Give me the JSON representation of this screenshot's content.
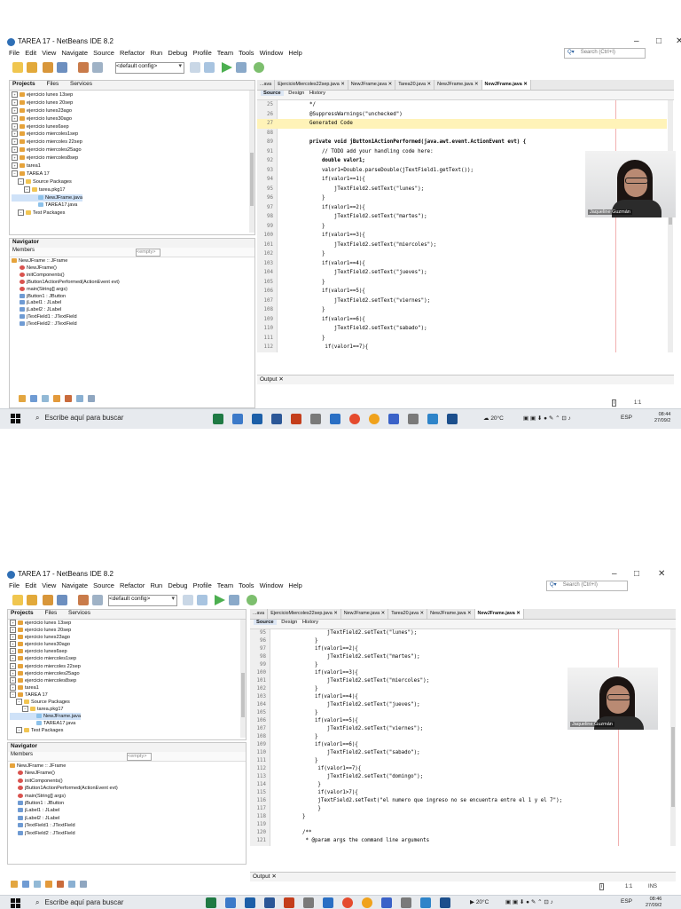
{
  "window": {
    "title": "TAREA 17 - NetBeans IDE 8.2",
    "minimize": "–",
    "maximize": "□",
    "close": "✕"
  },
  "menu": [
    "File",
    "Edit",
    "View",
    "Navigate",
    "Source",
    "Refactor",
    "Run",
    "Debug",
    "Profile",
    "Team",
    "Tools",
    "Window",
    "Help"
  ],
  "search_placeholder": "Search (Ctrl+I)",
  "config_select": "<default config>",
  "projects_tabs": [
    "Projects",
    "Files",
    "Services"
  ],
  "projects": [
    {
      "label": "ejercicio lunes 13sep",
      "indent": 0
    },
    {
      "label": "ejercicio lunes 20sep",
      "indent": 0
    },
    {
      "label": "ejercicio lunes23ago",
      "indent": 0
    },
    {
      "label": "ejercicio lunes30ago",
      "indent": 0
    },
    {
      "label": "ejercicio lunes6sep",
      "indent": 0
    },
    {
      "label": "ejercicio miercoles1sep",
      "indent": 0
    },
    {
      "label": "ejercicio miercoles 22sep",
      "indent": 0
    },
    {
      "label": "ejercicio miercoles25ago",
      "indent": 0
    },
    {
      "label": "ejercicio miercoles8sep",
      "indent": 0
    },
    {
      "label": "tarea1",
      "indent": 0
    },
    {
      "label": "TAREA 17",
      "indent": 0
    },
    {
      "label": "Source Packages",
      "indent": 1
    },
    {
      "label": "tarea.pkg17",
      "indent": 2
    },
    {
      "label": "NewJFrame.java",
      "indent": 3
    },
    {
      "label": "TAREA17.java",
      "indent": 3
    },
    {
      "label": "Test Packages",
      "indent": 1
    }
  ],
  "navigator": {
    "title": "Navigator",
    "members_label": "Members",
    "empty_select": "<empty>",
    "items": [
      {
        "label": "NewJFrame :: JFrame",
        "indent": 0
      },
      {
        "label": "NewJFrame()",
        "indent": 1
      },
      {
        "label": "initComponents()",
        "indent": 1
      },
      {
        "label": "jButton1ActionPerformed(ActionEvent evt)",
        "indent": 1
      },
      {
        "label": "main(String[] args)",
        "indent": 1
      },
      {
        "label": "jButton1 : JButton",
        "indent": 1
      },
      {
        "label": "jLabel1 : JLabel",
        "indent": 1
      },
      {
        "label": "jLabel2 : JLabel",
        "indent": 1
      },
      {
        "label": "jTextField1 : JTextField",
        "indent": 1
      },
      {
        "label": "jTextField2 : JTextField",
        "indent": 1
      }
    ]
  },
  "editor_tabs": [
    "...ava",
    "EjercicioMiercoles22sep.java",
    "NewJFrame.java",
    "Tarea20.java",
    "NewJFrame.java",
    "NewJFrame.java"
  ],
  "editor_toolbar": {
    "source": "Source",
    "design": "Design",
    "history": "History"
  },
  "code_top": [
    {
      "n": "25",
      "t": "  */"
    },
    {
      "n": "26",
      "t": "  @SuppressWarnings(\"unchecked\")"
    },
    {
      "n": "27",
      "t": "  Generated Code"
    },
    {
      "n": "88",
      "t": ""
    },
    {
      "n": "89",
      "t": "  private void jButton1ActionPerformed(java.awt.event.ActionEvent evt) {"
    },
    {
      "n": "91",
      "t": "      // TODO add your handling code here:"
    },
    {
      "n": "92",
      "t": "      double valor1;"
    },
    {
      "n": "93",
      "t": "      valor1=Double.parseDouble(jTextField1.getText());"
    },
    {
      "n": "94",
      "t": "      if(valor1==1){"
    },
    {
      "n": "95",
      "t": "          jTextField2.setText(\"lunes\");"
    },
    {
      "n": "96",
      "t": "      }"
    },
    {
      "n": "97",
      "t": "      if(valor1==2){"
    },
    {
      "n": "98",
      "t": "          jTextField2.setText(\"martes\");"
    },
    {
      "n": "99",
      "t": "      }"
    },
    {
      "n": "100",
      "t": "      if(valor1==3){"
    },
    {
      "n": "101",
      "t": "          jTextField2.setText(\"miercoles\");"
    },
    {
      "n": "102",
      "t": "      }"
    },
    {
      "n": "103",
      "t": "      if(valor1==4){"
    },
    {
      "n": "104",
      "t": "          jTextField2.setText(\"jueves\");"
    },
    {
      "n": "105",
      "t": "      }"
    },
    {
      "n": "106",
      "t": "      if(valor1==5){"
    },
    {
      "n": "107",
      "t": "          jTextField2.setText(\"viernes\");"
    },
    {
      "n": "108",
      "t": "      }"
    },
    {
      "n": "109",
      "t": "      if(valor1==6){"
    },
    {
      "n": "110",
      "t": "          jTextField2.setText(\"sabado\");"
    },
    {
      "n": "111",
      "t": "      }"
    },
    {
      "n": "112",
      "t": "       if(valor1==7){"
    }
  ],
  "code_bottom": [
    {
      "n": "95",
      "t": "          jTextField2.setText(\"lunes\");"
    },
    {
      "n": "96",
      "t": "      }"
    },
    {
      "n": "97",
      "t": "      if(valor1==2){"
    },
    {
      "n": "98",
      "t": "          jTextField2.setText(\"martes\");"
    },
    {
      "n": "99",
      "t": "      }"
    },
    {
      "n": "100",
      "t": "      if(valor1==3){"
    },
    {
      "n": "101",
      "t": "          jTextField2.setText(\"miercoles\");"
    },
    {
      "n": "102",
      "t": "      }"
    },
    {
      "n": "103",
      "t": "      if(valor1==4){"
    },
    {
      "n": "104",
      "t": "          jTextField2.setText(\"jueves\");"
    },
    {
      "n": "105",
      "t": "      }"
    },
    {
      "n": "106",
      "t": "      if(valor1==5){"
    },
    {
      "n": "107",
      "t": "          jTextField2.setText(\"viernes\");"
    },
    {
      "n": "108",
      "t": "      }"
    },
    {
      "n": "109",
      "t": "      if(valor1==6){"
    },
    {
      "n": "110",
      "t": "          jTextField2.setText(\"sabado\");"
    },
    {
      "n": "111",
      "t": "      }"
    },
    {
      "n": "112",
      "t": "       if(valor1==7){"
    },
    {
      "n": "113",
      "t": "          jTextField2.setText(\"domingo\");"
    },
    {
      "n": "114",
      "t": "       }"
    },
    {
      "n": "115",
      "t": "       if(valor1>7){"
    },
    {
      "n": "116",
      "t": "       jTextField2.setText(\"el numero que ingreso no se encuentra entre el 1 y el 7\");"
    },
    {
      "n": "117",
      "t": "       }"
    },
    {
      "n": "118",
      "t": "  }"
    },
    {
      "n": "119",
      "t": ""
    },
    {
      "n": "120",
      "t": "  /**"
    },
    {
      "n": "121",
      "t": "   * @param args the command line arguments"
    }
  ],
  "webcam_name": "Jaqueline Guzmán",
  "output_tab": "Output",
  "status": {
    "position": "1:1",
    "mode_top": "",
    "mode_bottom": "INS"
  },
  "taskbar": {
    "search_text": "Escribe aquí para buscar",
    "weather": "20°C",
    "lang": "ESP",
    "time_top": "08:44",
    "date_top": "27/09/2",
    "time_bottom": "08:46",
    "date_bottom": "27/09/2"
  },
  "colors": {
    "accent": "#2f6fb5",
    "taskbar": "#e7eaee",
    "highlight": "#fff3b8"
  }
}
